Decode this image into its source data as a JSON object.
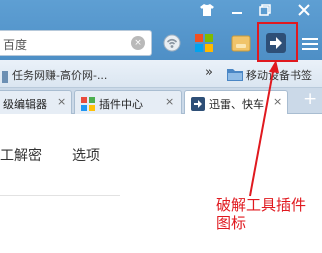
{
  "window": {
    "controls": [
      "shirt-icon",
      "minimize-icon",
      "restore-icon",
      "close-icon"
    ]
  },
  "toolbar": {
    "address_text": "百度",
    "clear_symbol": "×",
    "menu_icon": "hamburger-menu-icon"
  },
  "bookmarks": {
    "item1_label": "任务网赚-高价网-...",
    "more_label": "»",
    "item2_label": "移动设备书签"
  },
  "tabs": [
    {
      "label": "级编辑器",
      "close": "×"
    },
    {
      "label": "插件中心",
      "close": "×"
    },
    {
      "label": "迅雷、快车",
      "close": "×"
    }
  ],
  "new_tab_label": "+",
  "content": {
    "nav": [
      "工解密",
      "选项"
    ]
  },
  "annotation": {
    "text": "破解工具插件\n图标",
    "line1": "破解工具插件",
    "line2": "图标",
    "color": "#e0191f"
  }
}
